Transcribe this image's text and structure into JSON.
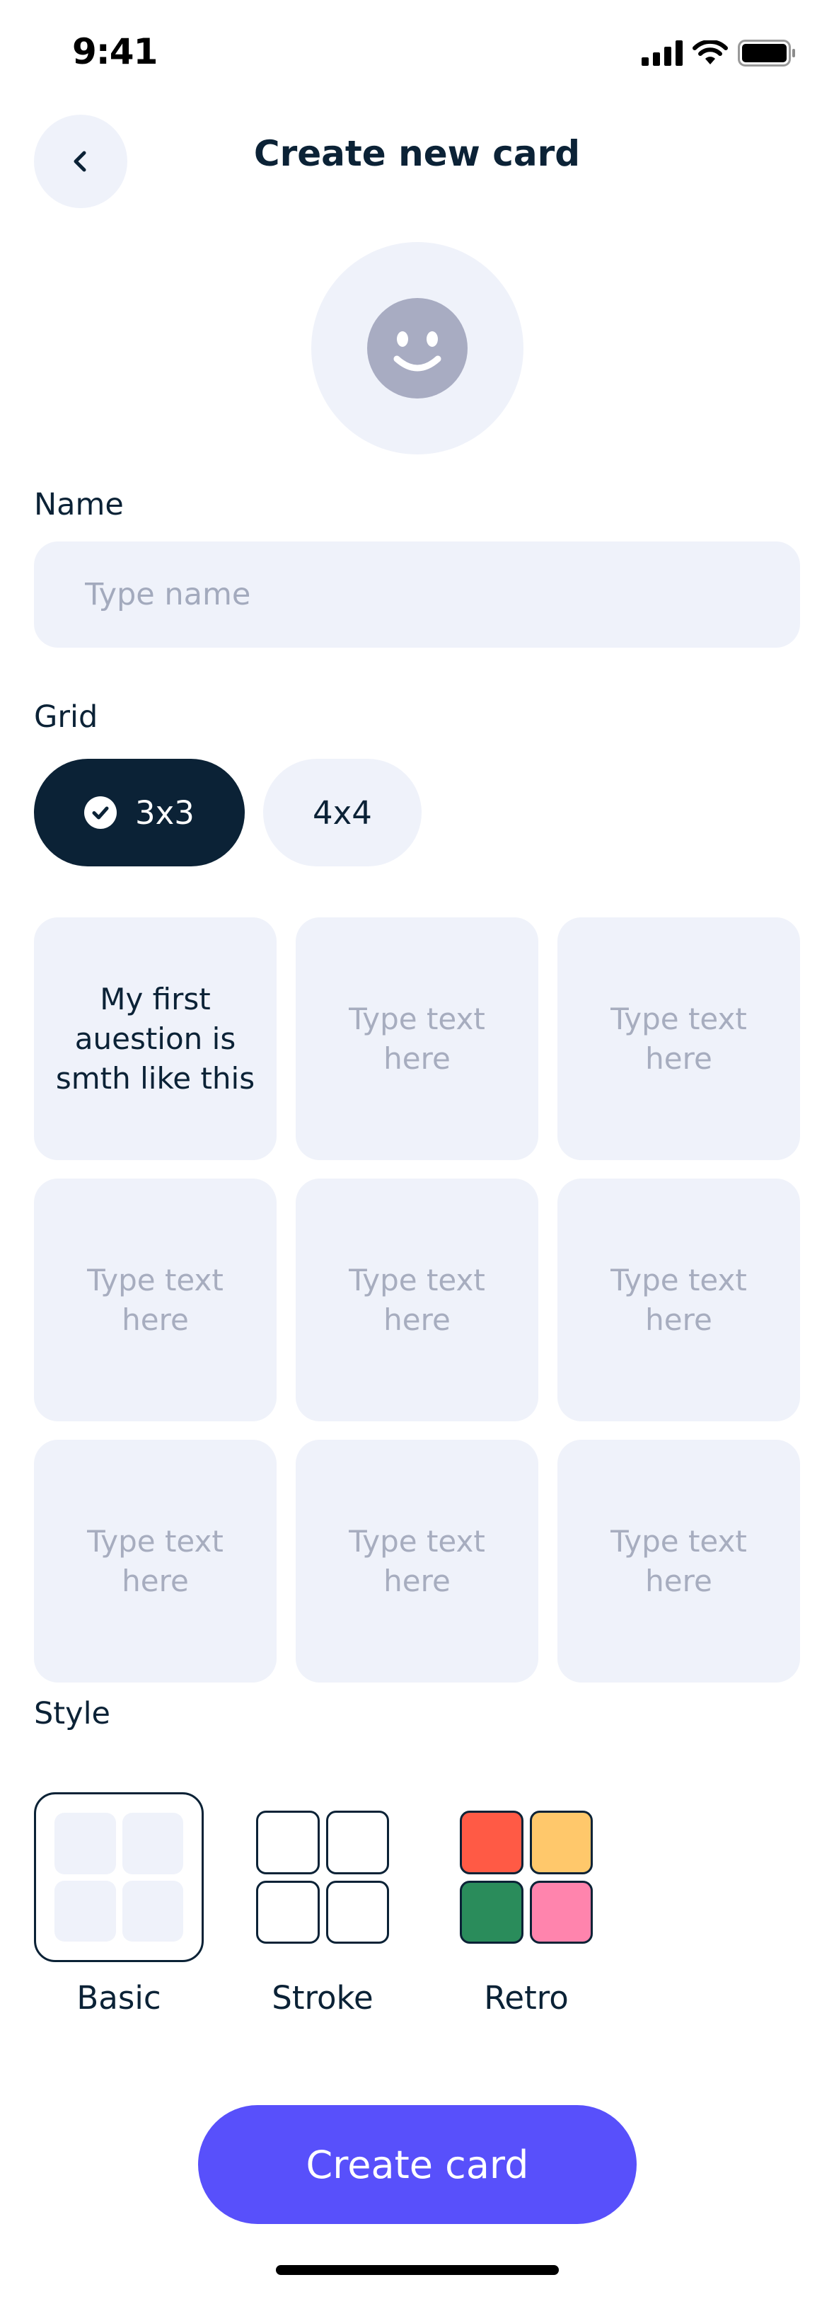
{
  "status_bar": {
    "time": "9:41",
    "icons": [
      "cellular-signal-icon",
      "wifi-icon",
      "battery-icon"
    ]
  },
  "header": {
    "title": "Create new card",
    "back_icon": "chevron-left-icon"
  },
  "avatar": {
    "icon": "smiley-face-icon"
  },
  "name_field": {
    "label": "Name",
    "placeholder": "Type name",
    "value": ""
  },
  "grid": {
    "label": "Grid",
    "options": [
      {
        "label": "3x3",
        "selected": true
      },
      {
        "label": "4x4",
        "selected": false
      }
    ],
    "check_icon": "check-circle-icon"
  },
  "cells": [
    {
      "text": "My first\nauestion is\nsmth like this",
      "filled": true
    },
    {
      "text": "Type text\nhere",
      "filled": false
    },
    {
      "text": "Type text\nhere",
      "filled": false
    },
    {
      "text": "Type text\nhere",
      "filled": false
    },
    {
      "text": "Type text\nhere",
      "filled": false
    },
    {
      "text": "Type text\nhere",
      "filled": false
    },
    {
      "text": "Type text\nhere",
      "filled": false
    },
    {
      "text": "Type text\nhere",
      "filled": false
    },
    {
      "text": "Type text\nhere",
      "filled": false
    }
  ],
  "style": {
    "label": "Style",
    "options": [
      {
        "name": "Basic",
        "selected": true
      },
      {
        "name": "Stroke",
        "selected": false
      },
      {
        "name": "Retro",
        "selected": false
      }
    ],
    "retro_colors": [
      "#ff5a45",
      "#ffc86b",
      "#2a8c5b",
      "#ff84ad"
    ]
  },
  "cta": {
    "label": "Create card"
  },
  "colors": {
    "primary_dark": "#0b2236",
    "accent": "#5850fb",
    "surface": "#eff2fa",
    "placeholder": "#a7adbf"
  }
}
